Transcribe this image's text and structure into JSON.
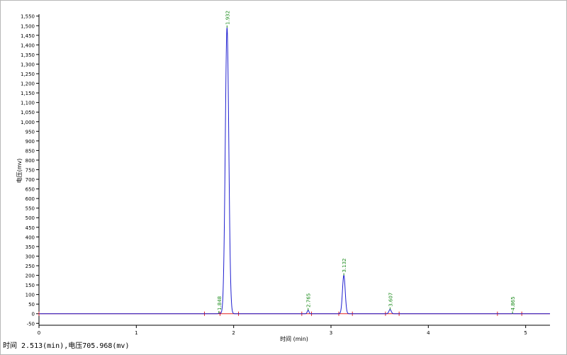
{
  "status_bar": {
    "text": "时间 2.513(min),电压705.968(mv)"
  },
  "chart_data": {
    "type": "line",
    "xlabel": "时间 (min)",
    "ylabel": "电压(mv)",
    "xlim": [
      0,
      5.25
    ],
    "ylim": [
      -60,
      1560
    ],
    "x_ticks": [
      0,
      1,
      2,
      3,
      4,
      5
    ],
    "y_ticks": [
      -50,
      0,
      50,
      100,
      150,
      200,
      250,
      300,
      350,
      400,
      450,
      500,
      550,
      600,
      650,
      700,
      750,
      800,
      850,
      900,
      950,
      1000,
      1050,
      1100,
      1150,
      1200,
      1250,
      1300,
      1350,
      1400,
      1450,
      1500,
      1550
    ],
    "y_tick_labels": [
      "-50",
      "0",
      "50",
      "100",
      "150",
      "200",
      "250",
      "300",
      "350",
      "400",
      "450",
      "500",
      "550",
      "600",
      "650",
      "700",
      "750",
      "800",
      "850",
      "900",
      "950",
      "1,000",
      "1,050",
      "1,100",
      "1,150",
      "1,200",
      "1,250",
      "1,300",
      "1,350",
      "1,400",
      "1,450",
      "1,500",
      "1,550"
    ],
    "grid": false,
    "colors": {
      "signal": "#1f1fd0",
      "baseline": "#e02020",
      "label": "#1a8a1a",
      "axis": "#000000"
    },
    "peaks": [
      {
        "label": "1.848",
        "time": 1.848,
        "height": 3
      },
      {
        "label": "1.932",
        "time": 1.932,
        "height": 1490
      },
      {
        "label": "2.765",
        "time": 2.765,
        "height": 18
      },
      {
        "label": "3.132",
        "time": 3.132,
        "height": 200
      },
      {
        "label": "3.607",
        "time": 3.607,
        "height": 22
      },
      {
        "label": "4.865",
        "time": 4.865,
        "height": 1
      }
    ],
    "baseline_segments": [
      [
        0.0,
        1.7
      ],
      [
        1.7,
        1.86
      ],
      [
        1.86,
        2.05
      ],
      [
        2.05,
        2.7
      ],
      [
        2.7,
        2.8
      ],
      [
        2.8,
        3.08
      ],
      [
        3.08,
        3.22
      ],
      [
        3.22,
        3.56
      ],
      [
        3.56,
        3.7
      ],
      [
        3.7,
        4.71
      ],
      [
        4.71,
        4.96
      ],
      [
        4.96,
        5.25
      ]
    ]
  }
}
